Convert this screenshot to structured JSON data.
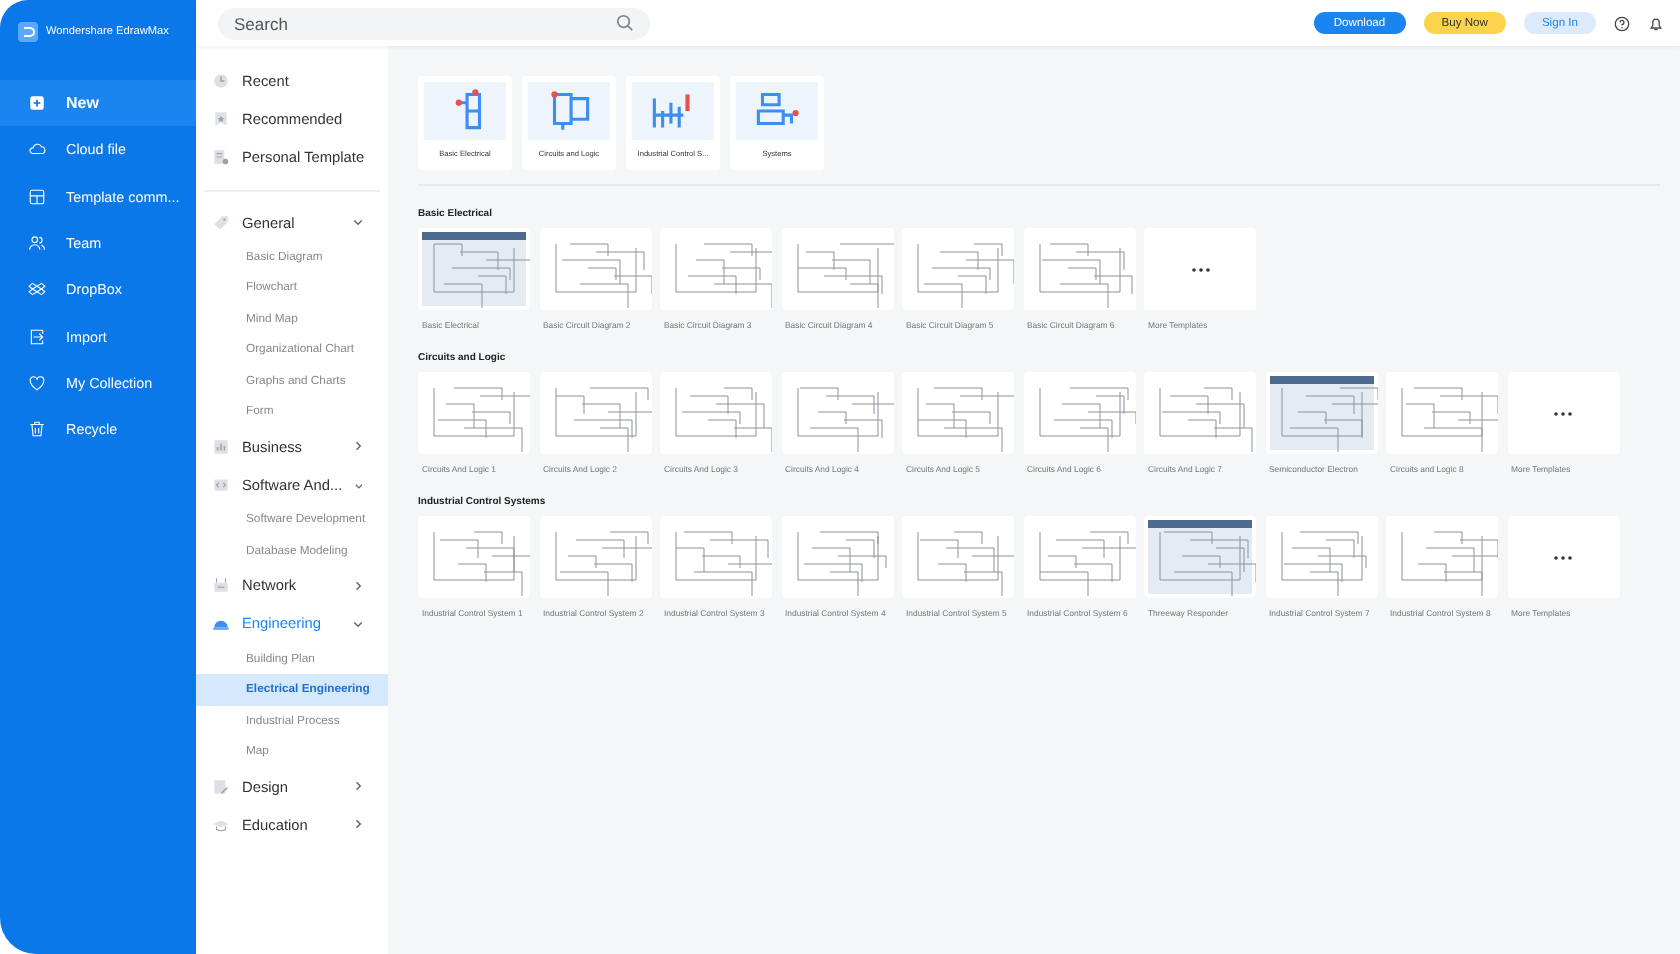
{
  "app": {
    "title": "Wondershare EdrawMax"
  },
  "sidebar": {
    "items": [
      {
        "label": "New",
        "selected": true
      },
      {
        "label": "Cloud file",
        "selected": false
      },
      {
        "label": "Template comm...",
        "selected": false
      },
      {
        "label": "Team",
        "selected": false
      },
      {
        "label": "DropBox",
        "selected": false
      },
      {
        "label": "Import",
        "selected": false
      },
      {
        "label": "My Collection",
        "selected": false
      },
      {
        "label": "Recycle",
        "selected": false
      }
    ]
  },
  "search": {
    "placeholder": "Search"
  },
  "header_buttons": [
    {
      "label": "Download",
      "kind": "primary"
    },
    {
      "label": "Buy Now",
      "kind": "buy"
    },
    {
      "label": "Sign In",
      "kind": "light"
    }
  ],
  "categories": {
    "top": [
      {
        "label": "Recent"
      },
      {
        "label": "Recommended"
      },
      {
        "label": "Personal Template"
      }
    ],
    "groups": [
      {
        "label": "General",
        "expanded": true,
        "selected": false,
        "children": [
          {
            "label": "Basic Diagram",
            "selected": false
          },
          {
            "label": "Flowchart",
            "selected": false
          },
          {
            "label": "Mind Map",
            "selected": false
          },
          {
            "label": "Organizational Chart",
            "selected": false
          },
          {
            "label": "Graphs and Charts",
            "selected": false
          },
          {
            "label": "Form",
            "selected": false
          }
        ]
      },
      {
        "label": "Business",
        "expanded": false,
        "selected": false
      },
      {
        "label": "Software And...",
        "expanded": true,
        "selected": false,
        "children": [
          {
            "label": "Software Development",
            "selected": false
          },
          {
            "label": "Database Modeling",
            "selected": false
          }
        ]
      },
      {
        "label": "Network",
        "expanded": false,
        "selected": false
      },
      {
        "label": "Engineering",
        "expanded": true,
        "selected": true,
        "children": [
          {
            "label": "Building Plan",
            "selected": false
          },
          {
            "label": "Electrical Engineering",
            "selected": true
          },
          {
            "label": "Industrial Process",
            "selected": false
          },
          {
            "label": "Map",
            "selected": false
          }
        ]
      },
      {
        "label": "Design",
        "expanded": false,
        "selected": false
      },
      {
        "label": "Education",
        "expanded": false,
        "selected": false
      }
    ]
  },
  "subcategories": [
    {
      "label": "Basic Electrical"
    },
    {
      "label": "Circuits and Logic"
    },
    {
      "label": "Industrial Control S..."
    },
    {
      "label": "Systems"
    }
  ],
  "sections": [
    {
      "title": "Basic Electrical",
      "templates": [
        {
          "label": "Basic Electrical",
          "kind": "framed"
        },
        {
          "label": "Basic Circuit Diagram 2",
          "kind": "diagram"
        },
        {
          "label": "Basic Circuit Diagram 3",
          "kind": "diagram"
        },
        {
          "label": "Basic Circuit Diagram 4",
          "kind": "diagram"
        },
        {
          "label": "Basic Circuit Diagram 5",
          "kind": "diagram"
        },
        {
          "label": "Basic Circuit Diagram 6",
          "kind": "diagram"
        },
        {
          "label": "More Templates",
          "kind": "more"
        }
      ]
    },
    {
      "title": "Circuits and Logic",
      "templates": [
        {
          "label": "Circuits And Logic 1",
          "kind": "diagram"
        },
        {
          "label": "Circuits And Logic 2",
          "kind": "diagram"
        },
        {
          "label": "Circuits And Logic 3",
          "kind": "diagram"
        },
        {
          "label": "Circuits And Logic 4",
          "kind": "diagram"
        },
        {
          "label": "Circuits And Logic 5",
          "kind": "diagram"
        },
        {
          "label": "Circuits And Logic 6",
          "kind": "diagram"
        },
        {
          "label": "Circuits And Logic 7",
          "kind": "diagram"
        },
        {
          "label": "Semiconductor Electron",
          "kind": "framed"
        },
        {
          "label": "Circuits and Logic 8",
          "kind": "diagram"
        },
        {
          "label": "More Templates",
          "kind": "more"
        }
      ]
    },
    {
      "title": "Industrial Control Systems",
      "templates": [
        {
          "label": "Industrial Control System 1",
          "kind": "diagram"
        },
        {
          "label": "Industrial Control System 2",
          "kind": "diagram"
        },
        {
          "label": "Industrial Control System 3",
          "kind": "diagram"
        },
        {
          "label": "Industrial Control System 4",
          "kind": "diagram"
        },
        {
          "label": "Industrial Control System 5",
          "kind": "diagram"
        },
        {
          "label": "Industrial Control System 6",
          "kind": "diagram"
        },
        {
          "label": "Threeway Responder",
          "kind": "framed"
        },
        {
          "label": "Industrial Control System 7",
          "kind": "diagram"
        },
        {
          "label": "Industrial Control System 8",
          "kind": "diagram"
        },
        {
          "label": "More Templates",
          "kind": "more"
        }
      ]
    }
  ]
}
